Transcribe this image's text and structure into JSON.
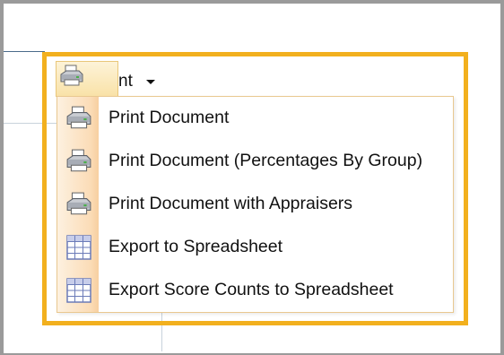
{
  "trigger": {
    "icon": "printer-icon",
    "label_partial": "nt",
    "arrow": "chevron-down-icon"
  },
  "menu": {
    "items": [
      {
        "label": "Print Document",
        "icon": "printer-icon"
      },
      {
        "label": "Print Document (Percentages By Group)",
        "icon": "printer-icon"
      },
      {
        "label": "Print Document with Appraisers",
        "icon": "printer-icon"
      },
      {
        "label": "Export to Spreadsheet",
        "icon": "spreadsheet-icon"
      },
      {
        "label": "Export Score Counts to Spreadsheet",
        "icon": "spreadsheet-icon"
      }
    ]
  },
  "colors": {
    "highlight_border": "#f2b01e",
    "menu_border": "#e9c890",
    "gutter": "#fbdcb7"
  }
}
